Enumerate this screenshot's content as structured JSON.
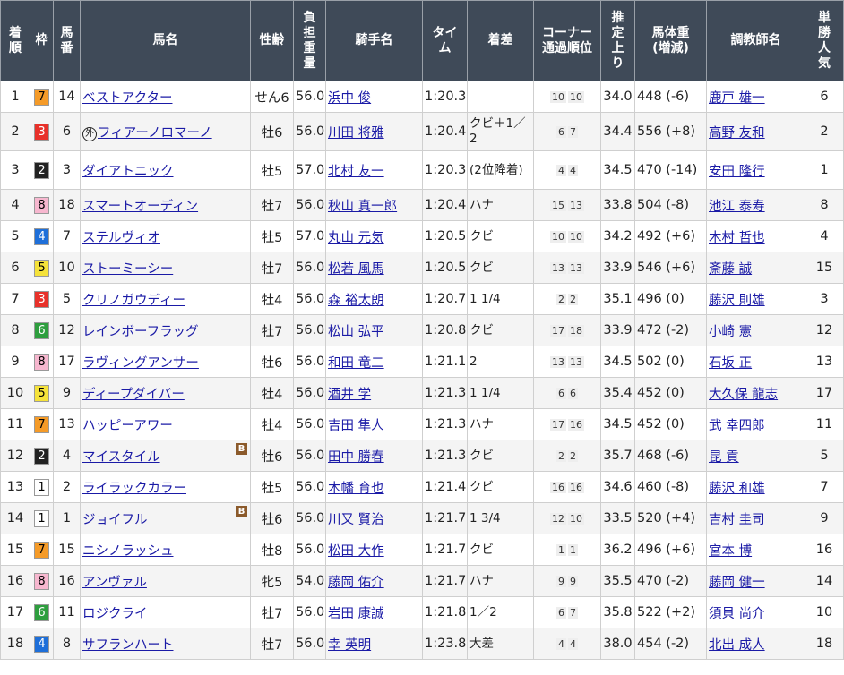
{
  "headers": [
    "着順",
    "枠",
    "馬番",
    "馬名",
    "性齢",
    "負担重量",
    "騎手名",
    "タイム",
    "着差",
    "コーナー通過順位",
    "推定上り",
    "馬体重(増減)",
    "調教師名",
    "単勝人気"
  ],
  "header_lines": [
    [
      "着",
      "順"
    ],
    [
      "枠"
    ],
    [
      "馬",
      "番"
    ],
    [
      "馬名"
    ],
    [
      "性齢"
    ],
    [
      "負",
      "担",
      "重",
      "量"
    ],
    [
      "騎手名"
    ],
    [
      "タイ",
      "ム"
    ],
    [
      "着差"
    ],
    [
      "コーナー",
      "通過順位"
    ],
    [
      "推",
      "定",
      "上",
      "り"
    ],
    [
      "馬体重",
      "(増減)"
    ],
    [
      "調教師名"
    ],
    [
      "単",
      "勝",
      "人",
      "気"
    ]
  ],
  "waku_colors": {
    "1": {
      "bg": "#ffffff",
      "fg": "#000000"
    },
    "2": {
      "bg": "#222222",
      "fg": "#ffffff"
    },
    "3": {
      "bg": "#e8312a",
      "fg": "#ffffff"
    },
    "4": {
      "bg": "#1e6fd9",
      "fg": "#ffffff"
    },
    "5": {
      "bg": "#f5e23a",
      "fg": "#000000"
    },
    "6": {
      "bg": "#2e9e3e",
      "fg": "#ffffff"
    },
    "7": {
      "bg": "#f59b28",
      "fg": "#000000"
    },
    "8": {
      "bg": "#f7b7cf",
      "fg": "#000000"
    }
  },
  "rows": [
    {
      "rank": "1",
      "waku": "7",
      "num": "14",
      "horse": "ベストアクター",
      "sexage": "せん6",
      "weight": "56.0",
      "jockey": "浜中 俊",
      "time": "1:20.3",
      "margin": "",
      "corner": [
        "10",
        "10"
      ],
      "last3f": "34.0",
      "bodyweight": "448 (-6)",
      "trainer": "鹿戸 雄一",
      "pop": "6"
    },
    {
      "rank": "2",
      "waku": "3",
      "num": "6",
      "horse": "フィアーノロマーノ",
      "foreign": "外",
      "sexage": "牡6",
      "weight": "56.0",
      "jockey": "川田 将雅",
      "time": "1:20.4",
      "margin": "クビ＋1／2",
      "corner": [
        "6",
        "7"
      ],
      "last3f": "34.4",
      "bodyweight": "556 (+8)",
      "trainer": "高野 友和",
      "pop": "2",
      "tall": true
    },
    {
      "rank": "3",
      "waku": "2",
      "num": "3",
      "horse": "ダイアトニック",
      "sexage": "牡5",
      "weight": "57.0",
      "jockey": "北村 友一",
      "time": "1:20.3",
      "margin": "(2位降着)",
      "corner": [
        "4",
        "4"
      ],
      "last3f": "34.5",
      "bodyweight": "470 (-14)",
      "trainer": "安田 隆行",
      "pop": "1",
      "tall": true
    },
    {
      "rank": "4",
      "waku": "8",
      "num": "18",
      "horse": "スマートオーディン",
      "sexage": "牡7",
      "weight": "56.0",
      "jockey": "秋山 真一郎",
      "time": "1:20.4",
      "margin": "ハナ",
      "corner": [
        "15",
        "13"
      ],
      "last3f": "33.8",
      "bodyweight": "504 (-8)",
      "trainer": "池江 泰寿",
      "pop": "8"
    },
    {
      "rank": "5",
      "waku": "4",
      "num": "7",
      "horse": "ステルヴィオ",
      "sexage": "牡5",
      "weight": "57.0",
      "jockey": "丸山 元気",
      "time": "1:20.5",
      "margin": "クビ",
      "corner": [
        "10",
        "10"
      ],
      "last3f": "34.2",
      "bodyweight": "492 (+6)",
      "trainer": "木村 哲也",
      "pop": "4"
    },
    {
      "rank": "6",
      "waku": "5",
      "num": "10",
      "horse": "ストーミーシー",
      "sexage": "牡7",
      "weight": "56.0",
      "jockey": "松若 風馬",
      "time": "1:20.5",
      "margin": "クビ",
      "corner": [
        "13",
        "13"
      ],
      "last3f": "33.9",
      "bodyweight": "546 (+6)",
      "trainer": "斎藤 誠",
      "pop": "15"
    },
    {
      "rank": "7",
      "waku": "3",
      "num": "5",
      "horse": "クリノガウディー",
      "sexage": "牡4",
      "weight": "56.0",
      "jockey": "森 裕太朗",
      "time": "1:20.7",
      "margin": "1 1/4",
      "corner": [
        "2",
        "2"
      ],
      "last3f": "35.1",
      "bodyweight": "496 (0)",
      "trainer": "藤沢 則雄",
      "pop": "3"
    },
    {
      "rank": "8",
      "waku": "6",
      "num": "12",
      "horse": "レインボーフラッグ",
      "sexage": "牡7",
      "weight": "56.0",
      "jockey": "松山 弘平",
      "time": "1:20.8",
      "margin": "クビ",
      "corner": [
        "17",
        "18"
      ],
      "last3f": "33.9",
      "bodyweight": "472 (-2)",
      "trainer": "小崎 憲",
      "pop": "12"
    },
    {
      "rank": "9",
      "waku": "8",
      "num": "17",
      "horse": "ラヴィングアンサー",
      "sexage": "牡6",
      "weight": "56.0",
      "jockey": "和田 竜二",
      "time": "1:21.1",
      "margin": "2",
      "corner": [
        "13",
        "13"
      ],
      "last3f": "34.5",
      "bodyweight": "502 (0)",
      "trainer": "石坂 正",
      "pop": "13"
    },
    {
      "rank": "10",
      "waku": "5",
      "num": "9",
      "horse": "ディープダイバー",
      "sexage": "牡4",
      "weight": "56.0",
      "jockey": "酒井 学",
      "time": "1:21.3",
      "margin": "1 1/4",
      "corner": [
        "6",
        "6"
      ],
      "last3f": "35.4",
      "bodyweight": "452 (0)",
      "trainer": "大久保 龍志",
      "pop": "17"
    },
    {
      "rank": "11",
      "waku": "7",
      "num": "13",
      "horse": "ハッピーアワー",
      "sexage": "牡4",
      "weight": "56.0",
      "jockey": "吉田 隼人",
      "time": "1:21.3",
      "margin": "ハナ",
      "corner": [
        "17",
        "16"
      ],
      "last3f": "34.5",
      "bodyweight": "452 (0)",
      "trainer": "武 幸四郎",
      "pop": "11"
    },
    {
      "rank": "12",
      "waku": "2",
      "num": "4",
      "horse": "マイスタイル",
      "blinker": "B",
      "sexage": "牡6",
      "weight": "56.0",
      "jockey": "田中 勝春",
      "time": "1:21.3",
      "margin": "クビ",
      "corner": [
        "2",
        "2"
      ],
      "last3f": "35.7",
      "bodyweight": "468 (-6)",
      "trainer": "昆 貢",
      "pop": "5"
    },
    {
      "rank": "13",
      "waku": "1",
      "num": "2",
      "horse": "ライラックカラー",
      "sexage": "牡5",
      "weight": "56.0",
      "jockey": "木幡 育也",
      "time": "1:21.4",
      "margin": "クビ",
      "corner": [
        "16",
        "16"
      ],
      "last3f": "34.6",
      "bodyweight": "460 (-8)",
      "trainer": "藤沢 和雄",
      "pop": "7"
    },
    {
      "rank": "14",
      "waku": "1",
      "num": "1",
      "horse": "ジョイフル",
      "blinker": "B",
      "sexage": "牡6",
      "weight": "56.0",
      "jockey": "川又 賢治",
      "time": "1:21.7",
      "margin": "1 3/4",
      "corner": [
        "12",
        "10"
      ],
      "last3f": "33.5",
      "bodyweight": "520 (+4)",
      "trainer": "吉村 圭司",
      "pop": "9"
    },
    {
      "rank": "15",
      "waku": "7",
      "num": "15",
      "horse": "ニシノラッシュ",
      "sexage": "牡8",
      "weight": "56.0",
      "jockey": "松田 大作",
      "time": "1:21.7",
      "margin": "クビ",
      "corner": [
        "1",
        "1"
      ],
      "last3f": "36.2",
      "bodyweight": "496 (+6)",
      "trainer": "宮本 博",
      "pop": "16"
    },
    {
      "rank": "16",
      "waku": "8",
      "num": "16",
      "horse": "アンヴァル",
      "sexage": "牝5",
      "weight": "54.0",
      "jockey": "藤岡 佑介",
      "time": "1:21.7",
      "margin": "ハナ",
      "corner": [
        "9",
        "9"
      ],
      "last3f": "35.5",
      "bodyweight": "470 (-2)",
      "trainer": "藤岡 健一",
      "pop": "14"
    },
    {
      "rank": "17",
      "waku": "6",
      "num": "11",
      "horse": "ロジクライ",
      "sexage": "牡7",
      "weight": "56.0",
      "jockey": "岩田 康誠",
      "time": "1:21.8",
      "margin": "1／2",
      "corner": [
        "6",
        "7"
      ],
      "last3f": "35.8",
      "bodyweight": "522 (+2)",
      "trainer": "須貝 尚介",
      "pop": "10"
    },
    {
      "rank": "18",
      "waku": "4",
      "num": "8",
      "horse": "サフランハート",
      "sexage": "牡7",
      "weight": "56.0",
      "jockey": "幸 英明",
      "time": "1:23.8",
      "margin": "大差",
      "corner": [
        "4",
        "4"
      ],
      "last3f": "38.0",
      "bodyweight": "454 (-2)",
      "trainer": "北出 成人",
      "pop": "18"
    }
  ]
}
